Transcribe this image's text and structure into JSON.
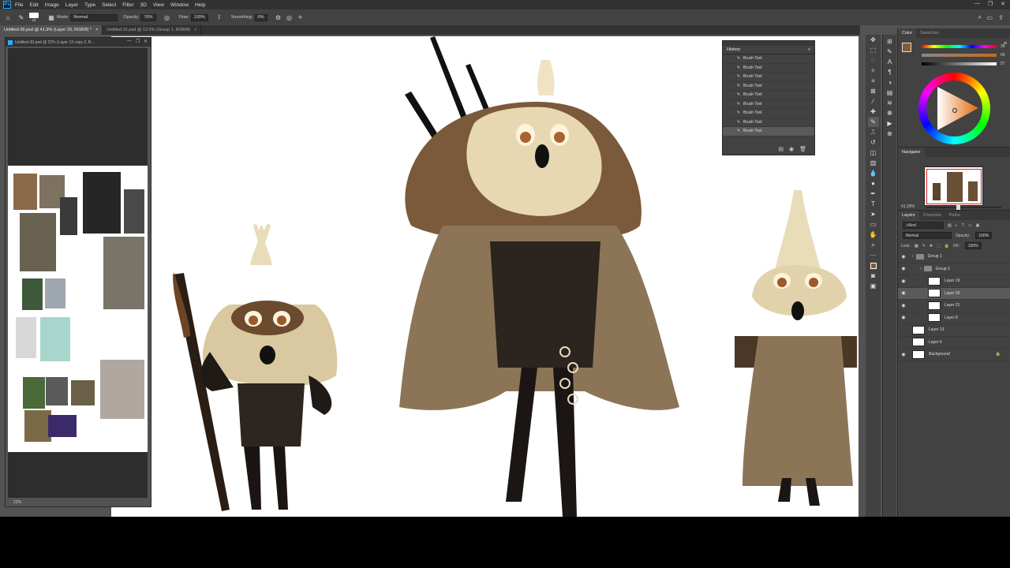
{
  "menubar": {
    "app_logo": "Ps",
    "items": [
      "File",
      "Edit",
      "Image",
      "Layer",
      "Type",
      "Select",
      "Filter",
      "3D",
      "View",
      "Window",
      "Help"
    ],
    "window_controls": [
      "—",
      "❐",
      "✕"
    ]
  },
  "options_bar": {
    "brush_size": "25",
    "mode_label": "Mode:",
    "mode_value": "Normal",
    "opacity_label": "Opacity:",
    "opacity_value": "76%",
    "flow_label": "Flow:",
    "flow_value": "100%",
    "smoothing_label": "Smoothing:",
    "smoothing_value": "0%"
  },
  "tabs": [
    {
      "label": "Untitled-36.psd @ 41.3% (Layer 20, RGB/8) *",
      "close": "×"
    },
    {
      "label": "Untitled-31.psd @ 12.5% (Group 1, RGB/8)",
      "close": "×"
    }
  ],
  "doc_window": {
    "title": "Untitled-30.psd @ 22% (Layer 13 copy 2, R...",
    "zoom": "22%",
    "controls": [
      "—",
      "❐",
      "✕"
    ]
  },
  "history": {
    "title": "History",
    "items": [
      "Brush Tool",
      "Brush Tool",
      "Brush Tool",
      "Brush Tool",
      "Brush Tool",
      "Brush Tool",
      "Brush Tool",
      "Brush Tool",
      "Brush Tool"
    ]
  },
  "color_panel": {
    "tabs": [
      "Color",
      "Swatches"
    ],
    "foreground": "#8a5a2e",
    "slider_values": [
      "28",
      "66",
      "57"
    ]
  },
  "navigator": {
    "title": "Navigator",
    "zoom": "41.29%"
  },
  "layers_panel": {
    "tabs": [
      "Layers",
      "Channels",
      "Paths"
    ],
    "kind_label": "Kind",
    "blend_mode": "Normal",
    "opacity_label": "Opacity:",
    "opacity_value": "100%",
    "lock_label": "Lock:",
    "fill_label": "Fill:",
    "fill_value": "100%",
    "layers": [
      {
        "name": "Group 1",
        "kind": "group",
        "visible": true,
        "indent": 0
      },
      {
        "name": "Group 2",
        "kind": "group",
        "visible": true,
        "indent": 1
      },
      {
        "name": "Layer 19",
        "kind": "layer",
        "visible": true,
        "indent": 2
      },
      {
        "name": "Layer 20",
        "kind": "layer",
        "visible": true,
        "indent": 2,
        "selected": true
      },
      {
        "name": "Layer 21",
        "kind": "layer",
        "visible": true,
        "indent": 2
      },
      {
        "name": "Layer 8",
        "kind": "layer",
        "visible": true,
        "indent": 2
      },
      {
        "name": "Layer 13",
        "kind": "layer",
        "visible": false,
        "indent": 0
      },
      {
        "name": "Layer 6",
        "kind": "layer",
        "visible": false,
        "indent": 0
      },
      {
        "name": "Background",
        "kind": "background",
        "visible": true,
        "indent": 0
      }
    ]
  },
  "colors": {
    "ui_dark": "#323232",
    "ui_mid": "#424242",
    "ui_workspace": "#535353",
    "accent_blue": "#31a8ff"
  }
}
